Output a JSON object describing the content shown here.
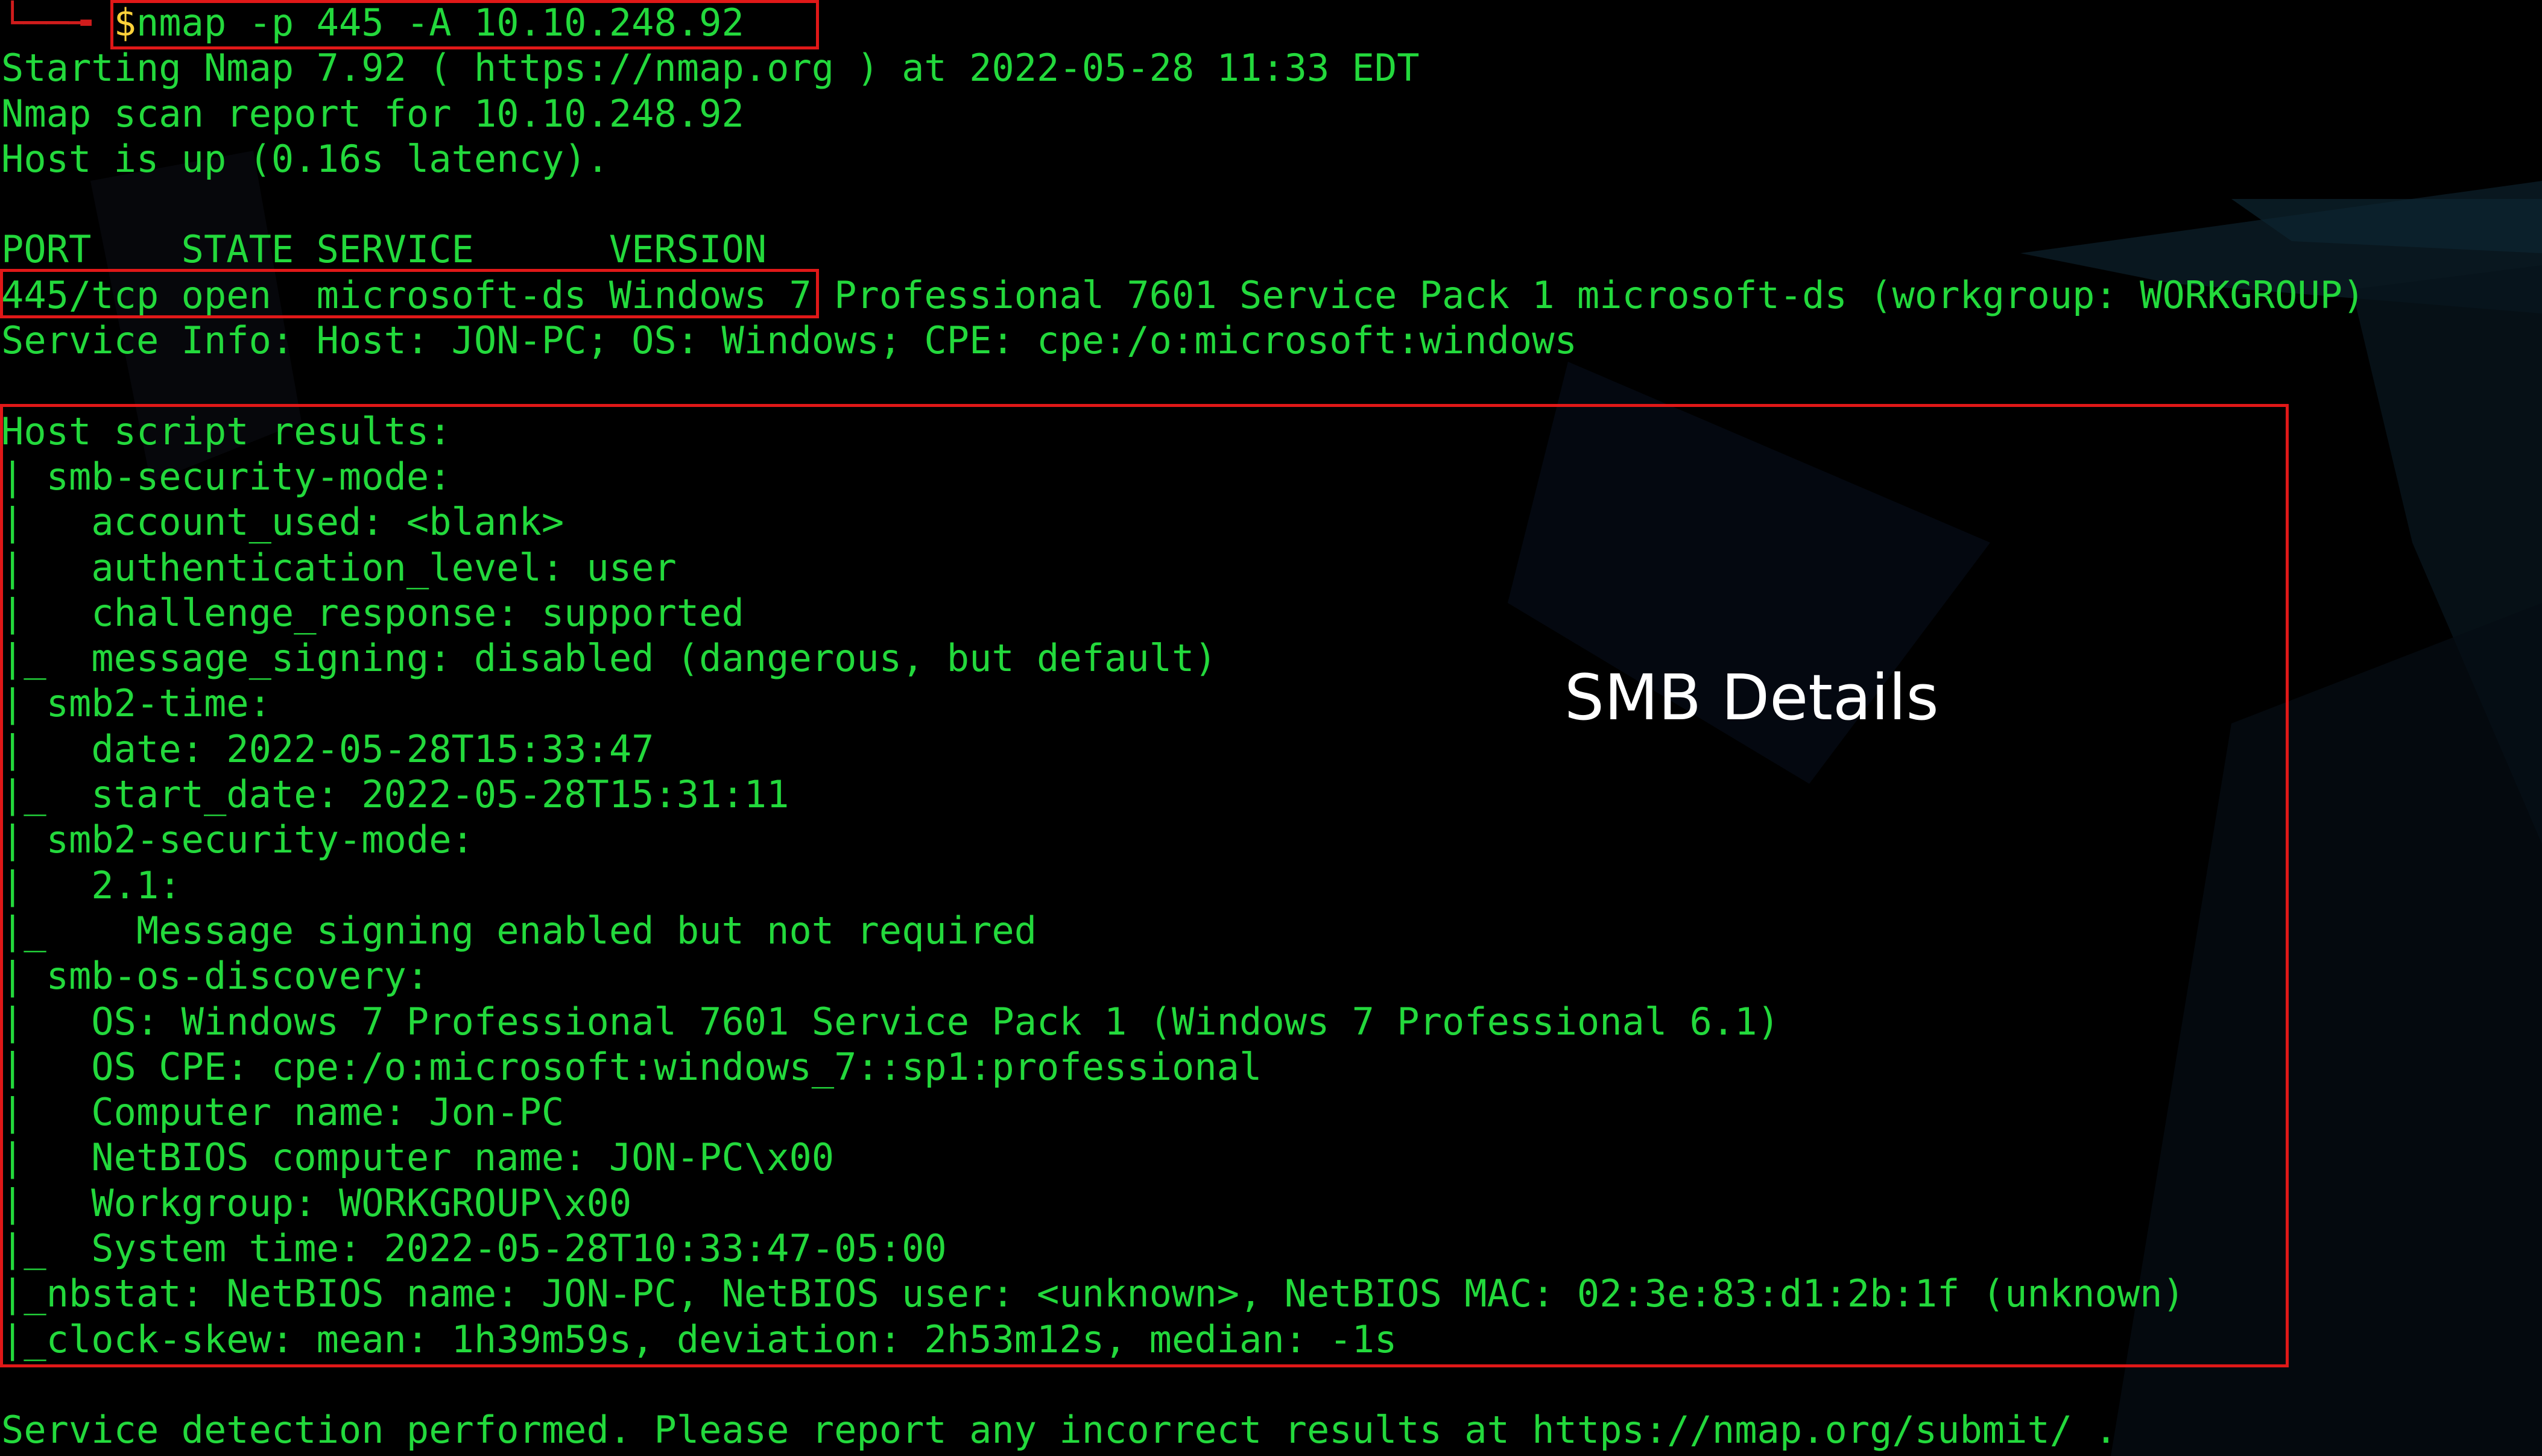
{
  "colors": {
    "text": "#23d93c",
    "background": "#000000",
    "highlight_box": "#e01818",
    "prompt_symbol": "#ffd23a",
    "prompt_arrow": "#d01c1c",
    "annotation_text": "#ffffff"
  },
  "prompt": {
    "arrow": "└──╼ ",
    "symbol": "$",
    "command": "nmap -p 445 -A 10.10.248.92"
  },
  "output": {
    "lines": [
      "Starting Nmap 7.92 ( https://nmap.org ) at 2022-05-28 11:33 EDT",
      "Nmap scan report for 10.10.248.92",
      "Host is up (0.16s latency).",
      "",
      "PORT    STATE SERVICE      VERSION",
      "445/tcp open  microsoft-ds Windows 7 Professional 7601 Service Pack 1 microsoft-ds (workgroup: WORKGROUP)",
      "Service Info: Host: JON-PC; OS: Windows; CPE: cpe:/o:microsoft:windows",
      "",
      "Host script results:",
      "| smb-security-mode:",
      "|   account_used: <blank>",
      "|   authentication_level: user",
      "|   challenge_response: supported",
      "|_  message_signing: disabled (dangerous, but default)",
      "| smb2-time:",
      "|   date: 2022-05-28T15:33:47",
      "|_  start_date: 2022-05-28T15:31:11",
      "| smb2-security-mode:",
      "|   2.1:",
      "|_    Message signing enabled but not required",
      "| smb-os-discovery:",
      "|   OS: Windows 7 Professional 7601 Service Pack 1 (Windows 7 Professional 6.1)",
      "|   OS CPE: cpe:/o:microsoft:windows_7::sp1:professional",
      "|   Computer name: Jon-PC",
      "|   NetBIOS computer name: JON-PC\\x00",
      "|   Workgroup: WORKGROUP\\x00",
      "|_  System time: 2022-05-28T10:33:47-05:00",
      "|_nbstat: NetBIOS name: JON-PC, NetBIOS user: <unknown>, NetBIOS MAC: 02:3e:83:d1:2b:1f (unknown)",
      "|_clock-skew: mean: 1h39m59s, deviation: 2h53m12s, median: -1s",
      "",
      "Service detection performed. Please report any incorrect results at https://nmap.org/submit/ ."
    ]
  },
  "annotation": {
    "label": "SMB Details"
  },
  "icons": {
    "background": "abstract-geometric-wallpaper"
  }
}
